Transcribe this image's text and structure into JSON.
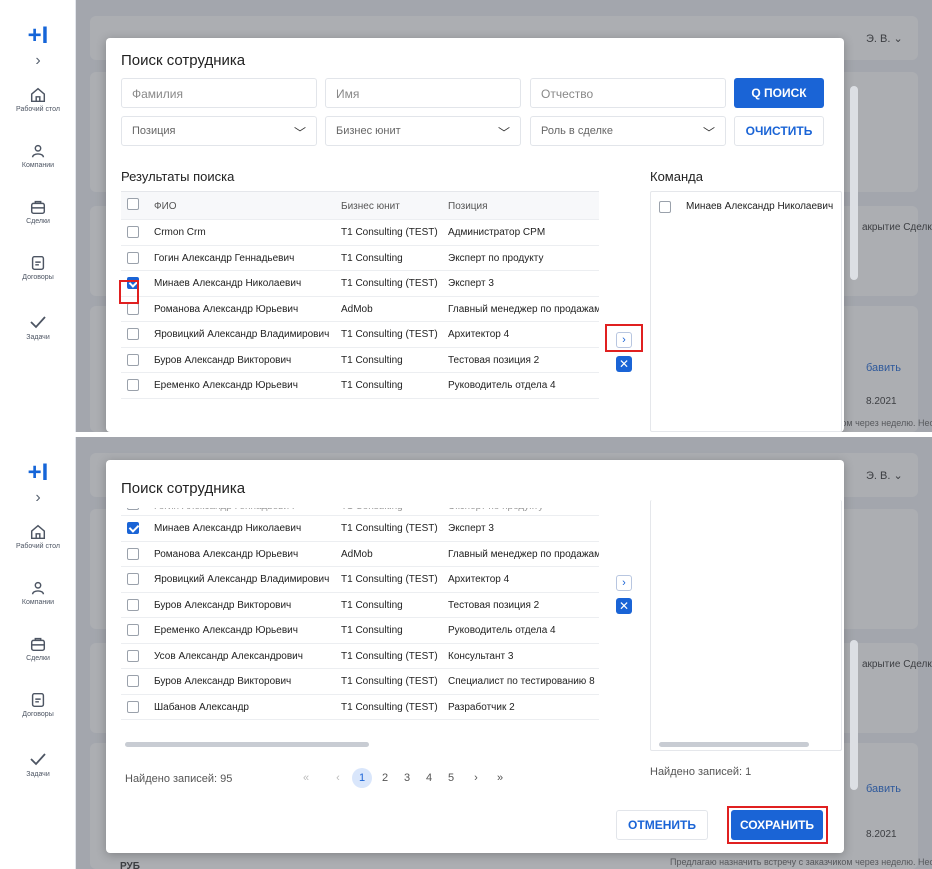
{
  "app": {
    "logo": "+I",
    "collapse": "›",
    "nav": [
      {
        "label": "Рабочий стол",
        "icon": "home-icon"
      },
      {
        "label": "Компании",
        "icon": "users-icon"
      },
      {
        "label": "Сделки",
        "icon": "briefcase-icon"
      },
      {
        "label": "Договоры",
        "icon": "document-icon"
      },
      {
        "label": "Задачи",
        "icon": "check-icon"
      }
    ]
  },
  "background": {
    "user": "Э. В. ⌄",
    "stage": "акрытие Сделк",
    "add_button": "бавить",
    "date": "8.2021",
    "note": "Предлагаю назначить встречу с заказчиком через неделю. Необходимо показать ему",
    "currency": "РУБ",
    "currency_controls": "✕ ⌄"
  },
  "dialog": {
    "title": "Поиск сотрудника",
    "search": {
      "last_name_placeholder": "Фамилия",
      "first_name_placeholder": "Имя",
      "middle_name_placeholder": "Отчество",
      "position_placeholder": "Позиция",
      "business_unit_placeholder": "Бизнес юнит",
      "deal_role_placeholder": "Роль в сделке",
      "search_button": "Q ПОИСК",
      "clear_button": "ОЧИСТИТЬ"
    },
    "results_title": "Результаты поиска",
    "team_title": "Команда",
    "columns": [
      "ФИО",
      "Бизнес юнит",
      "Позиция"
    ],
    "rows": [
      {
        "name": "Crmon Crm",
        "unit": "T1 Consulting (TEST)",
        "position": "Администратор CPM",
        "checked": false
      },
      {
        "name": "Гогин Александр Геннадьевич",
        "unit": "T1 Consulting",
        "position": "Эксперт по продукту",
        "checked": false
      },
      {
        "name": "Минаев Александр Николаевич",
        "unit": "T1 Consulting (TEST)",
        "position": "Эксперт 3",
        "checked": true
      },
      {
        "name": "Романова Александр Юрьевич",
        "unit": "AdMob",
        "position": "Главный менеджер по продажам",
        "checked": false
      },
      {
        "name": "Яровицкий Александр Владимирович",
        "unit": "T1 Consulting (TEST)",
        "position": "Архитектор 4",
        "checked": false
      },
      {
        "name": "Буров Александр Викторович",
        "unit": "T1 Consulting",
        "position": "Тестовая позиция 2",
        "checked": false
      },
      {
        "name": "Еременко Александр Юрьевич",
        "unit": "T1 Consulting",
        "position": "Руководитель отдела 4",
        "checked": false
      },
      {
        "name": "Усов Александр Александрович",
        "unit": "T1 Consulting (TEST)",
        "position": "Консультант 3",
        "checked": false
      },
      {
        "name": "Буров Александр Викторович",
        "unit": "T1 Consulting (TEST)",
        "position": "Специалист по тестированию 8",
        "checked": false
      },
      {
        "name": "Шабанов Александр",
        "unit": "T1 Consulting (TEST)",
        "position": "Разработчик 2",
        "checked": false
      }
    ],
    "team": [
      {
        "name": "Минаев Александр Николаевич"
      }
    ],
    "move_right": "›",
    "remove": "✕",
    "found_results": "Найдено записей: 95",
    "found_team": "Найдено записей: 1",
    "pagination": {
      "first": "«",
      "prev": "‹",
      "pages": [
        "1",
        "2",
        "3",
        "4",
        "5"
      ],
      "current": "1",
      "next": "›",
      "last": "»"
    },
    "cancel_button": "ОТМЕНИТЬ",
    "save_button": "СОХРАНИТЬ"
  }
}
